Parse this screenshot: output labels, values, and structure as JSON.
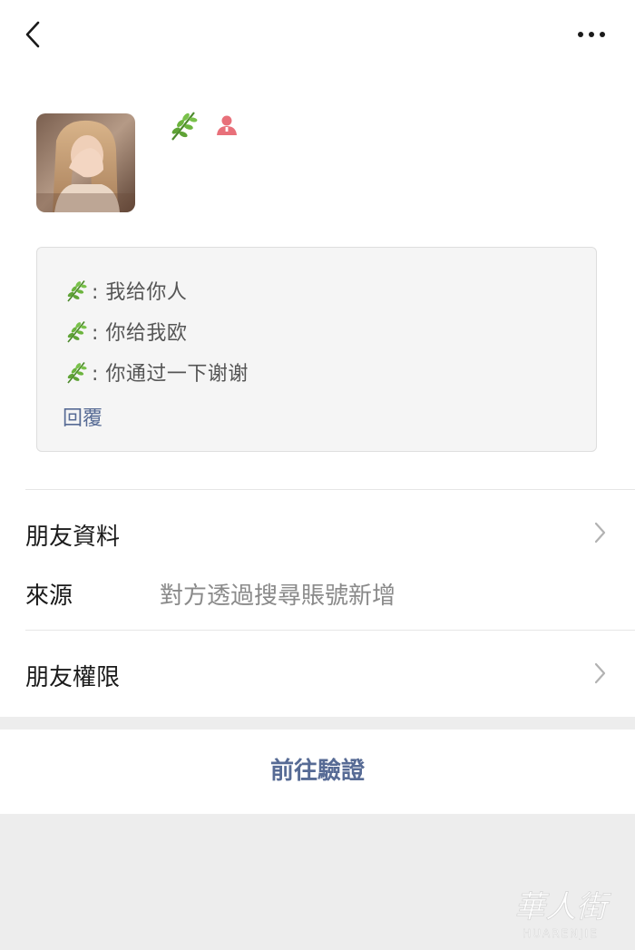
{
  "header": {
    "back_icon": "chevron-left-icon",
    "more_icon": "more-dots-icon"
  },
  "profile": {
    "avatar_icon": "avatar-photo",
    "name_icon": "leaf-emoji",
    "gender_icon": "female-icon",
    "gender_color": "#e8707a"
  },
  "messages": {
    "items": [
      {
        "sender_icon": "leaf-emoji",
        "text": ": 我给你人"
      },
      {
        "sender_icon": "leaf-emoji",
        "text": ": 你给我欧"
      },
      {
        "sender_icon": "leaf-emoji",
        "text": ": 你通过一下谢谢"
      }
    ],
    "reply_label": "回覆"
  },
  "details": {
    "friend_info_label": "朋友資料",
    "source_label": "來源",
    "source_value": "對方透過搜尋賬號新增",
    "permissions_label": "朋友權限"
  },
  "action": {
    "verify_label": "前往驗證"
  },
  "watermark": {
    "text": "華人街",
    "subtext": "HUARENJIE"
  },
  "colors": {
    "link": "#576b95",
    "background": "#ededed",
    "card": "#ffffff"
  }
}
